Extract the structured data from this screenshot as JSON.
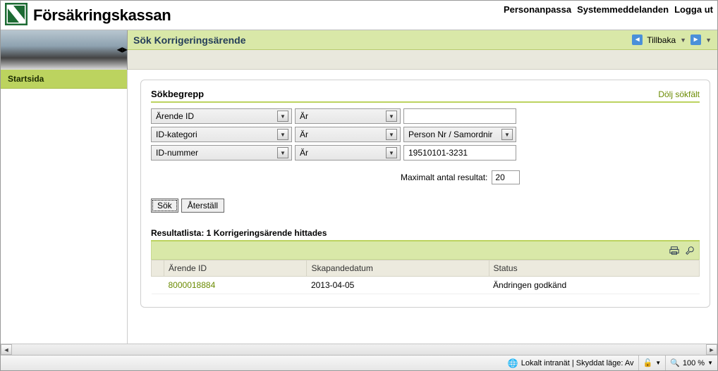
{
  "brand": {
    "name": "Försäkringskassan"
  },
  "topnav": {
    "personalize": "Personanpassa",
    "sysmsg": "Systemmeddelanden",
    "logout": "Logga ut"
  },
  "page": {
    "title": "Sök Korrigeringsärende",
    "back_label": "Tillbaka"
  },
  "leftnav": {
    "start": "Startsida"
  },
  "search": {
    "section_title": "Sökbegrepp",
    "hide_link": "Dölj sökfält",
    "rows": [
      {
        "field": "Ärende ID",
        "op": "Är",
        "value": "",
        "value_is_select": false
      },
      {
        "field": "ID-kategori",
        "op": "Är",
        "value": "Person Nr / Samordnir",
        "value_is_select": true
      },
      {
        "field": "ID-nummer",
        "op": "Är",
        "value": "19510101-3231",
        "value_is_select": false
      }
    ],
    "max_label": "Maximalt antal resultat:",
    "max_value": "20",
    "btn_search": "Sök",
    "btn_reset": "Återställ"
  },
  "results": {
    "heading": "Resultatlista: 1 Korrigeringsärende hittades",
    "columns": {
      "id": "Ärende ID",
      "created": "Skapandedatum",
      "status": "Status"
    },
    "rows": [
      {
        "id": "8000018884",
        "created": "2013-04-05",
        "status": "Ändringen godkänd"
      }
    ]
  },
  "statusbar": {
    "zone": "Lokalt intranät | Skyddat läge: Av",
    "zoom": "100 %"
  }
}
